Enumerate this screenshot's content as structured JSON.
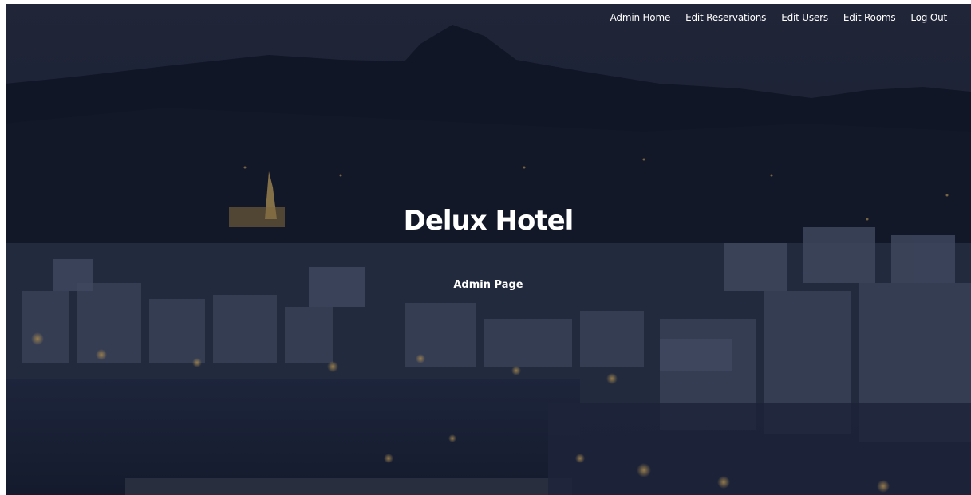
{
  "nav": {
    "items": [
      {
        "label": "Admin Home"
      },
      {
        "label": "Edit Reservations"
      },
      {
        "label": "Edit Users"
      },
      {
        "label": "Edit Rooms"
      },
      {
        "label": "Log Out"
      }
    ]
  },
  "hero": {
    "title": "Delux Hotel",
    "subtitle": "Admin Page"
  },
  "colors": {
    "sky": "#1f2840",
    "mountain": "#141a2a",
    "water": "#1c2740",
    "text": "#ffffff"
  }
}
